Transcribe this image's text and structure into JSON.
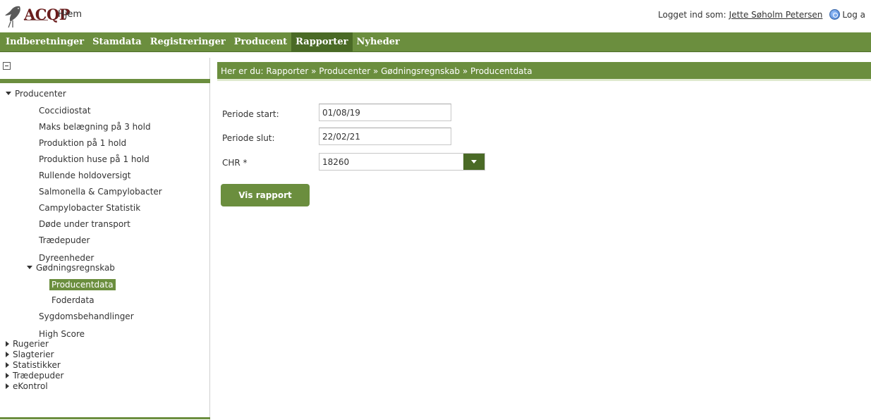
{
  "header": {
    "logo_text": "ACQP",
    "home_label": "Hjem",
    "login_prefix": "Logget ind som:",
    "user_name": "Jette Søholm Petersen",
    "logout_label": "Log a"
  },
  "nav": {
    "items": [
      "Indberetninger",
      "Stamdata",
      "Registreringer",
      "Producent",
      "Rapporter",
      "Nyheder"
    ],
    "active": "Rapporter"
  },
  "breadcrumb": "Her er du: Rapporter » Producenter » Gødningsregnskab » Producentdata",
  "sidebar": {
    "root": "Producenter",
    "children": [
      "Coccidiostat",
      "Maks belægning på 3 hold",
      "Produktion på 1 hold",
      "Produktion huse på 1 hold",
      "Rullende holdoversigt",
      "Salmonella & Campylobacter",
      "Campylobacter Statistik",
      "Døde under transport",
      "Trædepuder",
      "Dyreenheder"
    ],
    "group": "Gødningsregnskab",
    "group_children": [
      "Producentdata",
      "Foderdata"
    ],
    "after_group": [
      "Sygdomsbehandlinger",
      "High Score"
    ],
    "collapsed": [
      "Rugerier",
      "Slagterier",
      "Statistikker",
      "Trædepuder",
      "eKontrol"
    ],
    "selected": "Producentdata"
  },
  "form": {
    "period_start_label": "Periode start:",
    "period_start_value": "01/08/19",
    "period_end_label": "Periode slut:",
    "period_end_value": "22/02/21",
    "chr_label": "CHR *",
    "chr_value": "18260",
    "submit_label": "Vis rapport"
  },
  "colors": {
    "brand_green": "#6b8e3e",
    "active_green": "#4a6a26",
    "logo_red": "#6a1d1d"
  }
}
